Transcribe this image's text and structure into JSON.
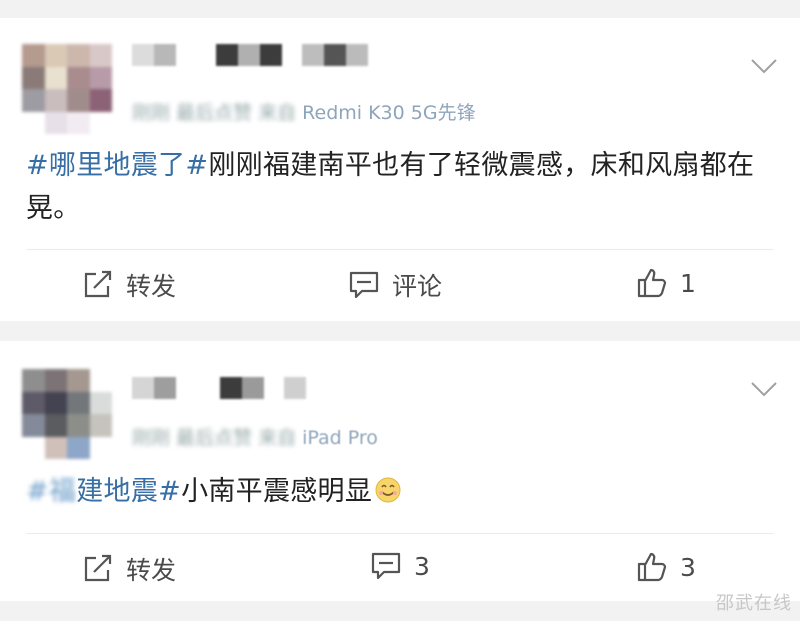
{
  "posts": [
    {
      "meta_blurred": "刚刚 最后点赞",
      "meta_source_blurred": "来自",
      "meta_source": "Redmi K30 5G先锋",
      "hashtag": "#哪里地震了#",
      "text": "刚刚福建南平也有了轻微震感，床和风扇都在晃。",
      "repost_label": "转发",
      "comment_label": "评论",
      "like_count": "1"
    },
    {
      "meta_blurred": "刚刚 最后点赞",
      "meta_source_blurred": "来自",
      "meta_source": "iPad Pro",
      "hashtag_blur": "#福",
      "hashtag": "建地震#",
      "text": "小南平震感明显",
      "emoji": "smile-emoji",
      "repost_label": "转发",
      "comment_count": "3",
      "like_count": "3"
    }
  ],
  "watermark": "邵武在线",
  "colors": {
    "hashtag": "#376ea5",
    "meta": "#939393",
    "background": "#f2f2f2",
    "card": "#ffffff"
  }
}
